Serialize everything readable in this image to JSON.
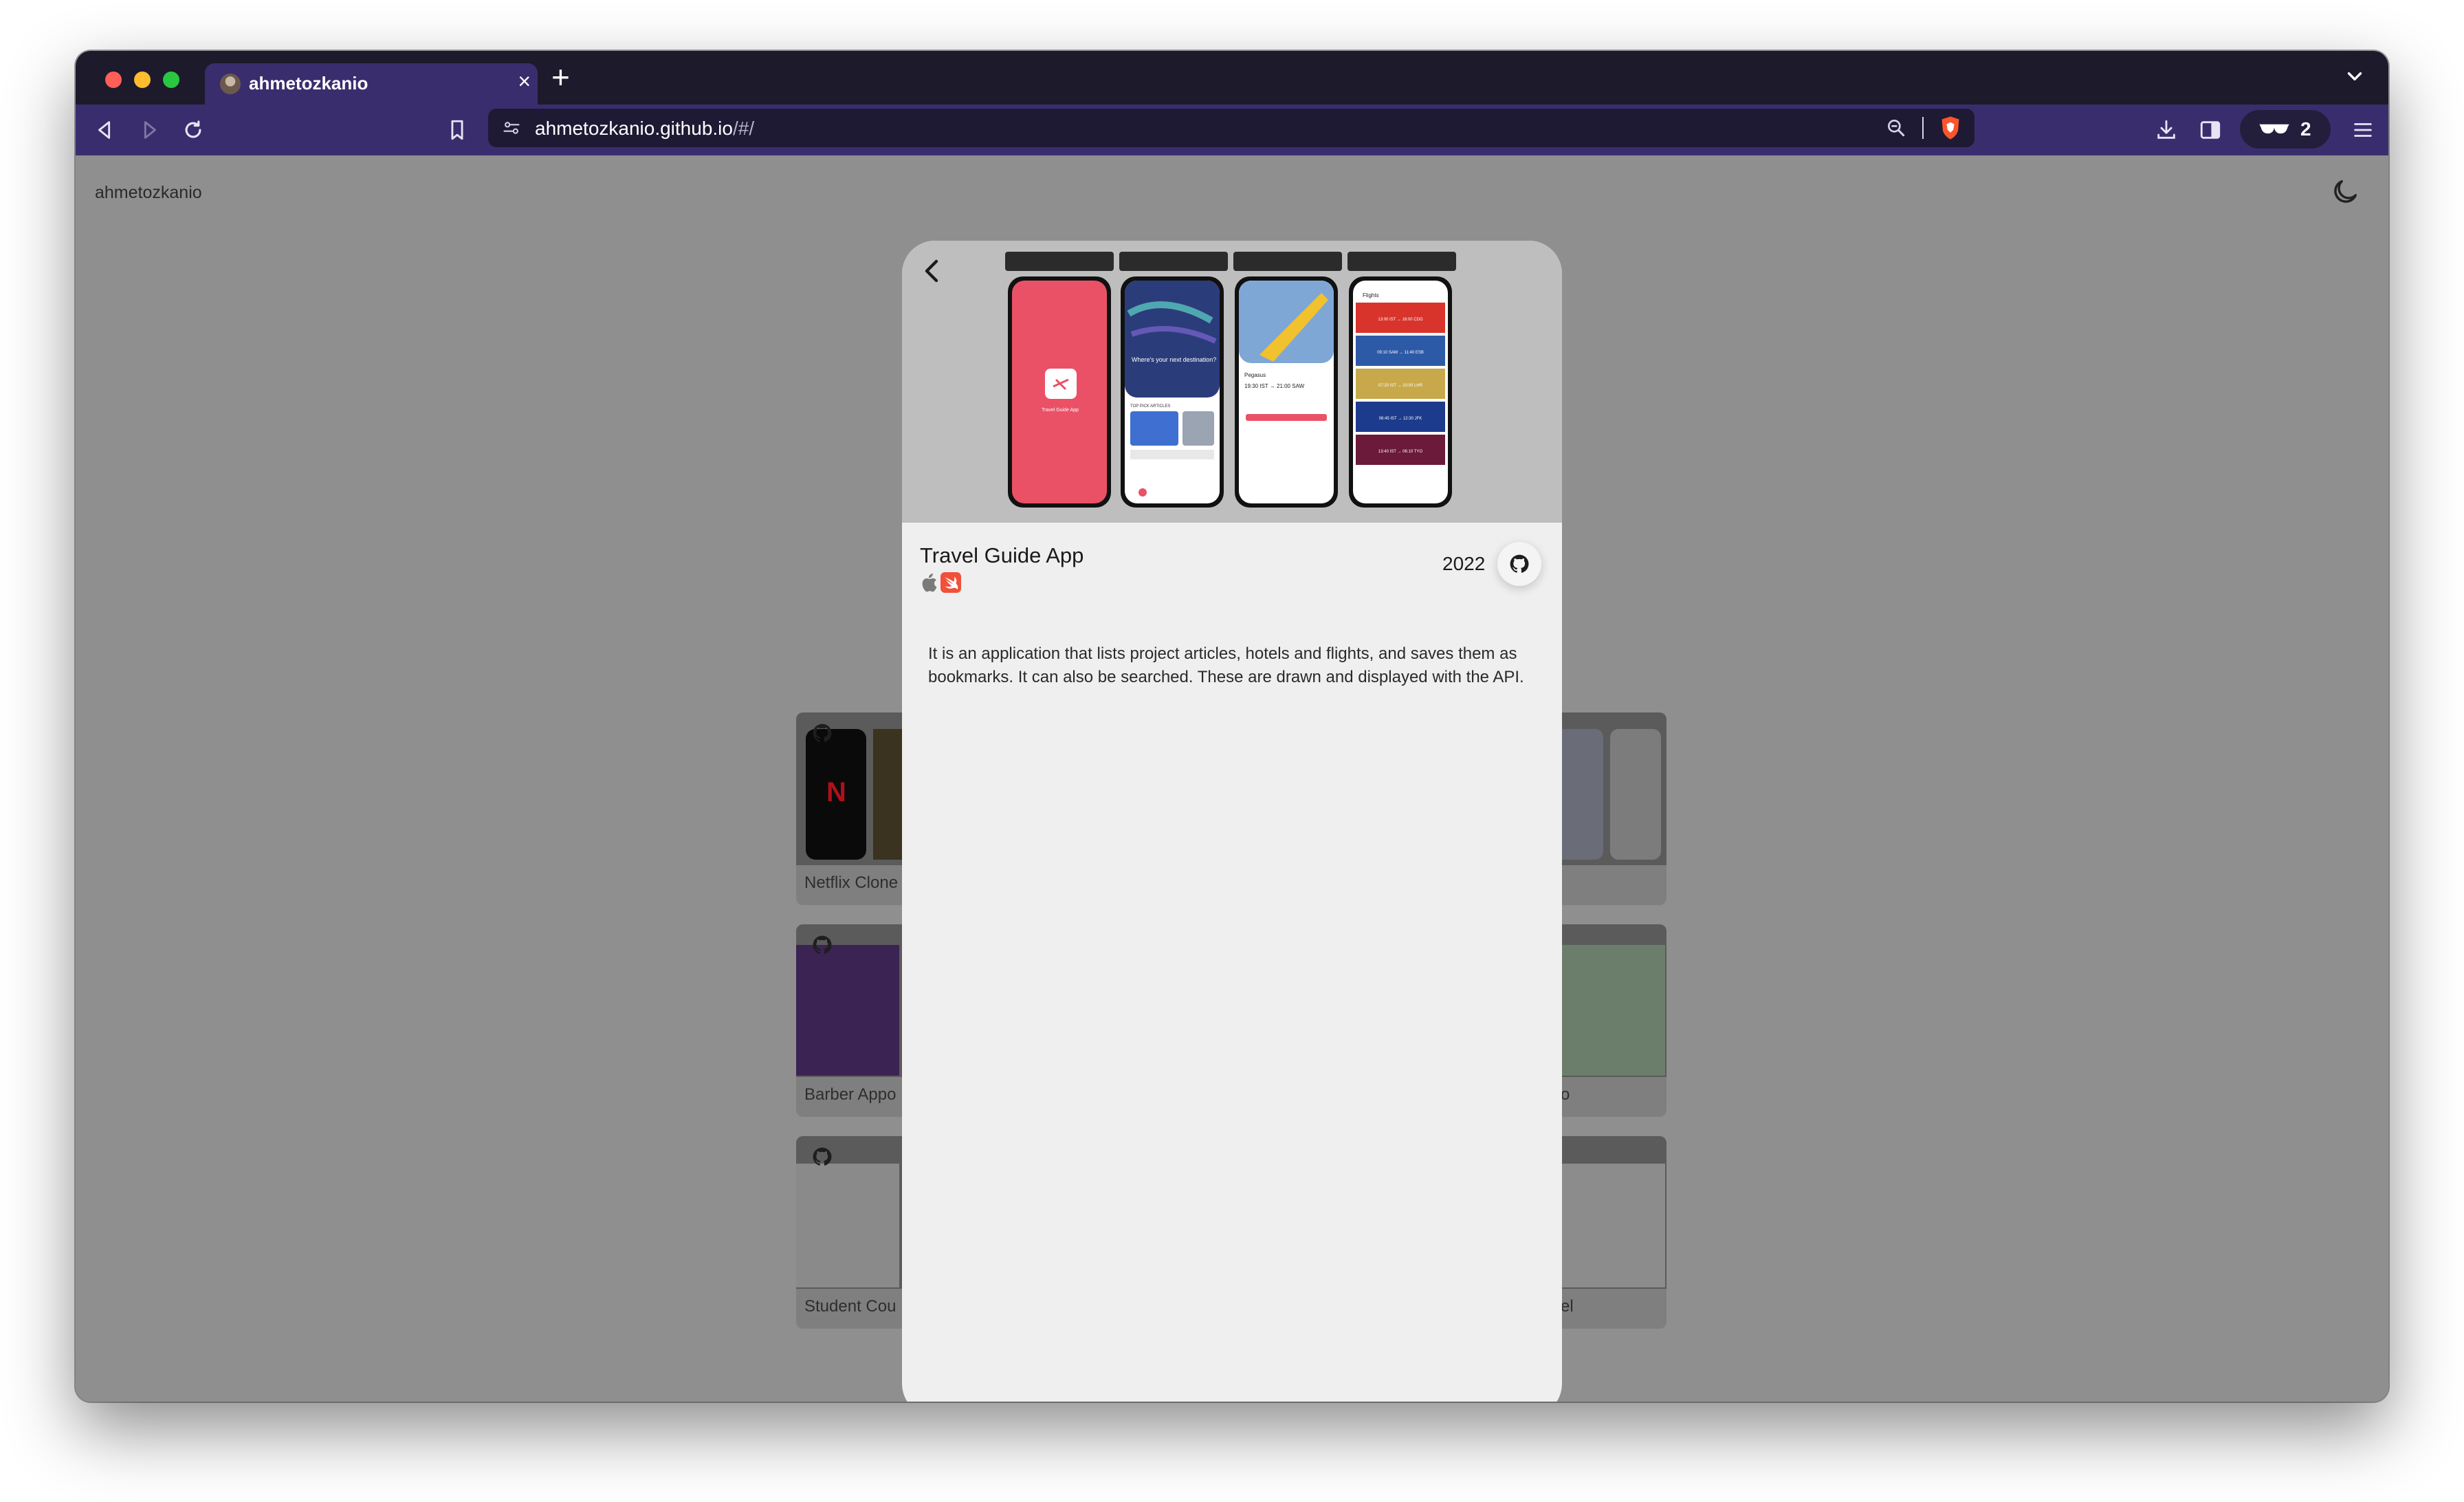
{
  "browser": {
    "tab": {
      "title": "ahmetozkanio",
      "close": "×"
    },
    "new_tab": "+",
    "url": {
      "host": "ahmetozkanio.github.io",
      "path": "/#/"
    },
    "vpn_count": "2"
  },
  "page": {
    "site_name": "ahmetozkanio",
    "cards": [
      {
        "title": "Netflix Clone",
        "right_title": ""
      },
      {
        "title": "Barber Appo",
        "right_title": "o"
      },
      {
        "title": "Student Cou",
        "right_title": "el"
      }
    ]
  },
  "modal": {
    "title": "Travel Guide App",
    "year": "2022",
    "description": "It is an application that lists project articles, hotels and flights, and saves them as bookmarks. It can also be searched. These are drawn and displayed with the API.",
    "screens": {
      "splash_label": "Travel Guide App",
      "headline": "Where's your next destination?",
      "section": "TOP PICK ARTICLES",
      "flight_airline": "Pegasus",
      "flight_time": "19:30 IST → 21:00 SAW",
      "flights_title": "Flights",
      "flight_rows": [
        "13:00 IST → 16:00 CDG",
        "09:10 SAW → 11:40 ESB",
        "07:20 IST → 10:00 LHR",
        "08:45 IST → 12:30 JFK",
        "13:40 IST → 06:10 TYO"
      ]
    }
  },
  "icons": {
    "back": "chevron-left-icon",
    "forward": "play-icon",
    "reload": "reload-icon",
    "bookmark": "bookmark-icon",
    "zoom": "zoom-icon",
    "github": "github-icon",
    "theme": "moon-icon"
  },
  "colors": {
    "tab_bar": "#1c1a2b",
    "toolbar": "#3a2d6e",
    "url_bar": "#1e1a34",
    "overlay": "#8f8f8f",
    "modal": "#efefef",
    "splash_red": "#ea5167"
  }
}
